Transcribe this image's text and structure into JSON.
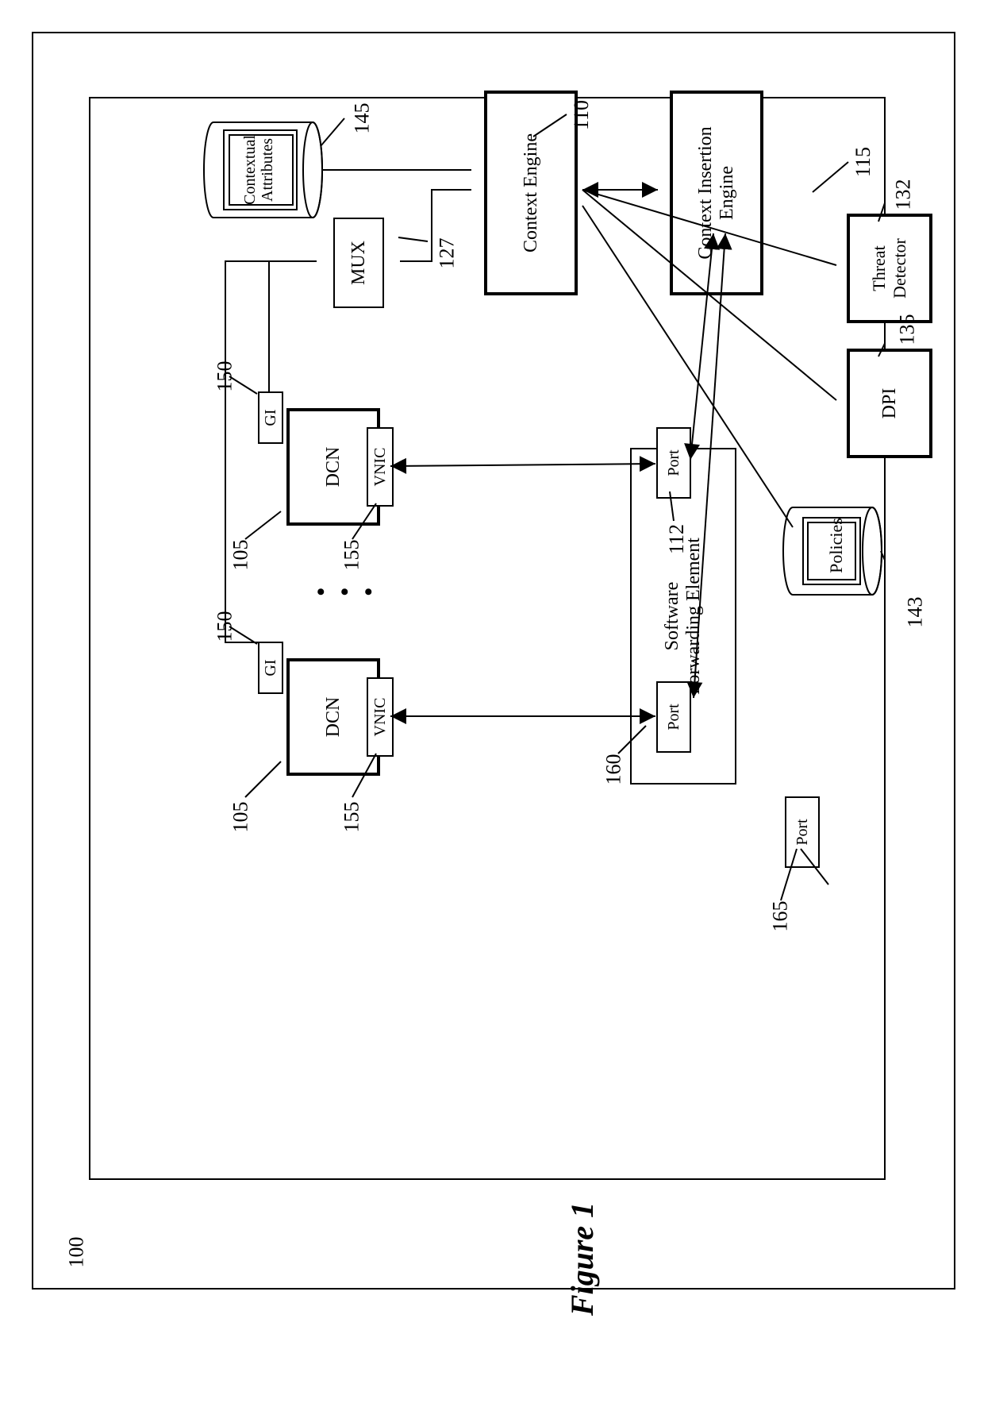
{
  "figure": {
    "caption": "Figure 1",
    "ref100": "100"
  },
  "blocks": {
    "dcn_left": {
      "gi": "GI",
      "name": "DCN",
      "vnic": "VNIC"
    },
    "dcn_right": {
      "gi": "GI",
      "name": "DCN",
      "vnic": "VNIC"
    },
    "mux": "MUX",
    "context_engine": "Context Engine",
    "context_insertion": "Context Insertion\nEngine",
    "threat_detector": "Threat\nDetector",
    "dpi": "DPI",
    "contextual_attrs": "Contextual\nAttributes",
    "policies": "Policies",
    "sfe": "Software\nForwarding Element",
    "port_a": "Port",
    "port_b": "Port",
    "port_c": "Port"
  },
  "refs": {
    "dcn_left_105": "105",
    "dcn_left_150": "150",
    "dcn_left_155": "155",
    "dcn_right_105": "105",
    "dcn_right_150": "150",
    "dcn_right_155": "155",
    "mux_127": "127",
    "context_engine_110": "110",
    "context_insertion_115": "115",
    "threat_132": "132",
    "dpi_135": "135",
    "contextual_145": "145",
    "policies_143": "143",
    "sfe_112": "112",
    "port_a_160": "160",
    "port_c_165": "165"
  }
}
